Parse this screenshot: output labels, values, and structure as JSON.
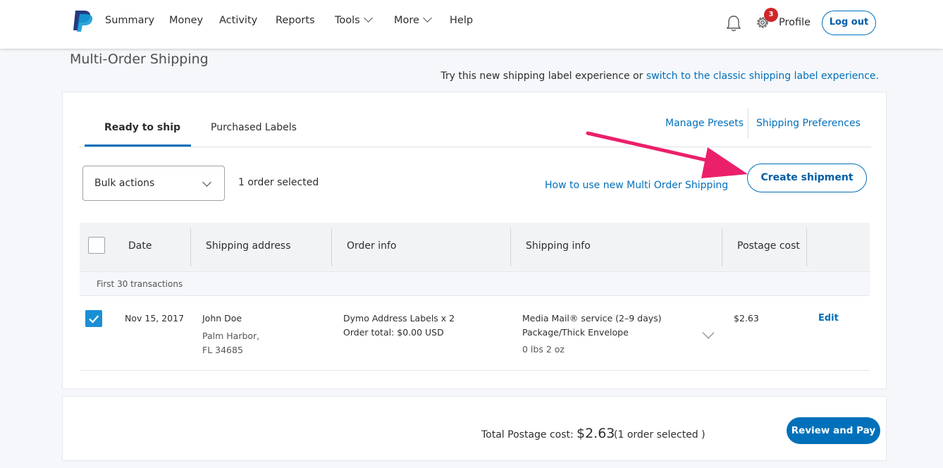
{
  "nav": {
    "items": [
      {
        "label": "Summary"
      },
      {
        "label": "Money"
      },
      {
        "label": "Activity"
      },
      {
        "label": "Reports"
      },
      {
        "label": "Tools"
      },
      {
        "label": "More"
      },
      {
        "label": "Help"
      }
    ],
    "notification_badge": "3",
    "profile_label": "Profile",
    "logout_label": "Log out",
    "icons": {
      "logo": "paypal-logo",
      "bell": "bell-icon",
      "gear": "gear-icon"
    }
  },
  "page": {
    "title": "Multi-Order Shipping",
    "try_text": "Try this new shipping label experience or ",
    "try_link": "switch to the classic shipping label experience.",
    "accent_color": "#0070ba",
    "arrow_color": "#ec1f6b"
  },
  "card": {
    "tabs": [
      {
        "label": "Ready to ship",
        "active": true
      },
      {
        "label": "Purchased Labels",
        "active": false
      }
    ],
    "manage_presets": "Manage Presets",
    "shipping_preferences": "Shipping Preferences",
    "bulk_actions": "Bulk actions",
    "order_count": "1 order selected",
    "how_to_link": "How to use new Multi Order Shipping",
    "create_shipment": "Create shipment"
  },
  "table": {
    "headers": [
      "Date",
      "Shipping address",
      "Order info",
      "Shipping info",
      "Postage cost"
    ],
    "group_label": "First 30 transactions",
    "rows": [
      {
        "checked": true,
        "date": "Nov 15, 2017",
        "name": "John Doe",
        "address_line1": "Palm Harbor,",
        "address_line2": "FL 34685",
        "order_item": "Dymo Address Labels x 2",
        "order_total": "Order total: $0.00 USD",
        "service": "Media Mail® service (2–9 days)",
        "package": "Package/Thick Envelope",
        "weight": "0 lbs 2 oz",
        "postage": "$2.63",
        "edit_label": "Edit"
      }
    ]
  },
  "footer": {
    "total_label": "Total Postage cost:",
    "total_amount": "$2.63",
    "total_count": "(1 order selected )",
    "review_button": "Review and Pay"
  }
}
